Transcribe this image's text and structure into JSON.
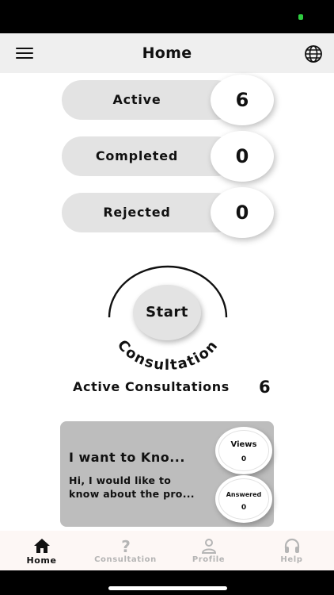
{
  "header": {
    "title": "Home",
    "menu_icon": "hamburger-menu-icon",
    "language_icon": "globe-icon"
  },
  "stats": [
    {
      "label": "Active",
      "value": "6"
    },
    {
      "label": "Completed",
      "value": "0"
    },
    {
      "label": "Rejected",
      "value": "0"
    }
  ],
  "start": {
    "button_label": "Start",
    "arc_text": "Consultation"
  },
  "active_consultations": {
    "title": "Active Consultations",
    "count": "6"
  },
  "card": {
    "title": "I want to Kno...",
    "body_line1": "Hi, I would like to",
    "body_line2": "know about the pro...",
    "views_label": "Views",
    "views_value": "0",
    "answered_label": "Answered",
    "answered_value": "0"
  },
  "tabs": [
    {
      "label": "Home",
      "icon": "home-icon",
      "active": true
    },
    {
      "label": "Consultation",
      "icon": "question-mark-icon",
      "active": false
    },
    {
      "label": "Profile",
      "icon": "person-icon",
      "active": false
    },
    {
      "label": "Help",
      "icon": "headphones-icon",
      "active": false
    }
  ],
  "colors": {
    "pill": "#e3e3e3",
    "card": "#bdbdbd",
    "tabbar": "#fdf7f5",
    "inactive_tab": "#b5b5b5"
  }
}
